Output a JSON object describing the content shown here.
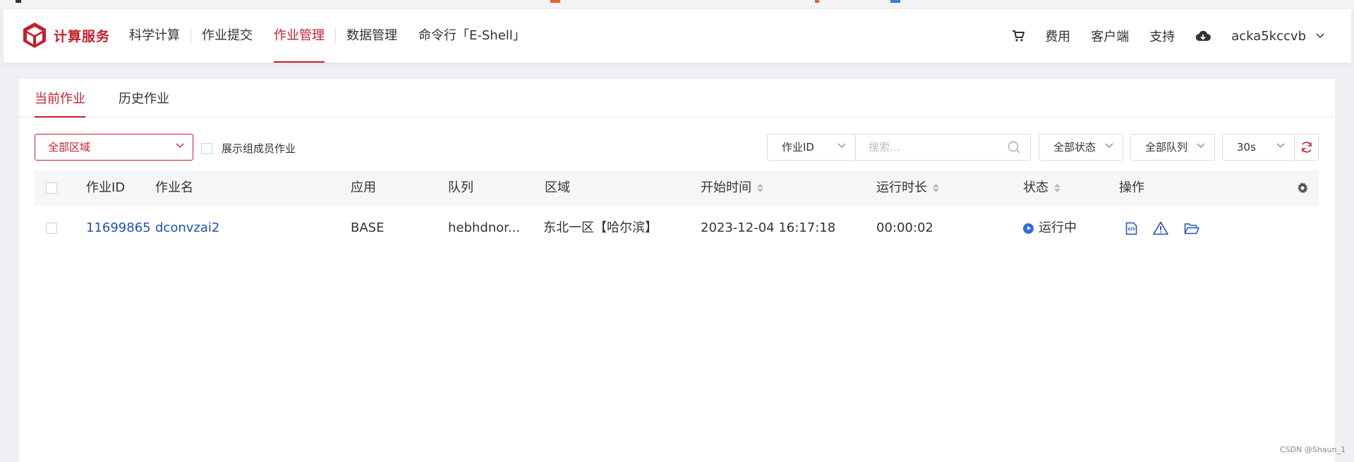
{
  "header": {
    "brand": "计算服务",
    "nav": [
      "科学计算",
      "作业提交",
      "作业管理",
      "数据管理",
      "命令行「E-Shell」"
    ],
    "active_nav": 2,
    "right": {
      "fee": "费用",
      "client": "客户端",
      "support": "支持",
      "username": "acka5kccvb"
    }
  },
  "tabs": {
    "current": "当前作业",
    "history": "历史作业"
  },
  "filters": {
    "region": "全部区域",
    "show_members": "展示组成员作业",
    "field": "作业ID",
    "search_placeholder": "搜索...",
    "status": "全部状态",
    "queue": "全部队列",
    "refresh_interval": "30s"
  },
  "table": {
    "columns": [
      "作业ID",
      "作业名",
      "应用",
      "队列",
      "区域",
      "开始时间",
      "运行时长",
      "状态",
      "操作"
    ],
    "rows": [
      {
        "job_id": "11699865",
        "name": "dconvzai2",
        "app": "BASE",
        "queue": "hebhdnor...",
        "region": "东北一区【哈尔滨】",
        "start": "2023-12-04 16:17:18",
        "duration": "00:00:02",
        "status": "运行中"
      }
    ]
  },
  "colors": {
    "accent": "#c81e2c",
    "link": "#1f4fbf",
    "running": "#2f6be8"
  },
  "watermark": "CSDN @Shaun_1"
}
